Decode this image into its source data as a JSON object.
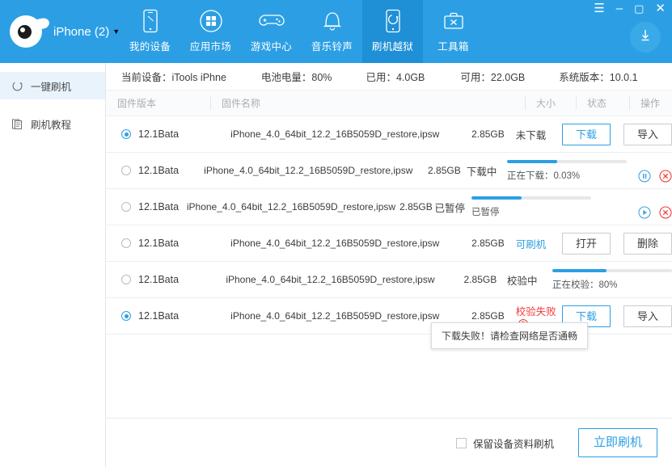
{
  "app": {
    "brand_name": "iPhone (2)",
    "brand_caret": "▼",
    "logo_icon": "itools-eye-logo"
  },
  "topnav": {
    "tabs": [
      {
        "label": "我的设备",
        "icon": "phone-icon",
        "active": false
      },
      {
        "label": "应用市场",
        "icon": "grid-apps-icon",
        "active": false
      },
      {
        "label": "游戏中心",
        "icon": "gamepad-icon",
        "active": false
      },
      {
        "label": "音乐铃声",
        "icon": "bell-icon",
        "active": false
      },
      {
        "label": "刷机越狱",
        "icon": "phone-refresh-icon",
        "active": true
      },
      {
        "label": "工具箱",
        "icon": "toolbox-icon",
        "active": false
      }
    ],
    "window_controls": [
      {
        "name": "menu-icon",
        "glyph": "☰"
      },
      {
        "name": "minimize-icon",
        "glyph": "–"
      },
      {
        "name": "maximize-icon",
        "glyph": "▢"
      },
      {
        "name": "close-icon",
        "glyph": "✕"
      }
    ],
    "download_button_icon": "download-arrow-icon"
  },
  "sidebar": {
    "items": [
      {
        "label": "一键刷机",
        "icon": "refresh-circle-icon",
        "active": true
      },
      {
        "label": "刷机教程",
        "icon": "document-icon",
        "active": false
      }
    ]
  },
  "device_bar": {
    "current_device": "当前设备：iTools iPhne",
    "battery": "电池电量：80%",
    "used": "已用：4.0GB",
    "available": "可用：22.0GB",
    "system_version": "系统版本：10.0.1"
  },
  "table": {
    "headers": {
      "version": "固件版本",
      "name": "固件名称",
      "size": "大小",
      "state": "状态",
      "action": "操作"
    },
    "rows": [
      {
        "selected": true,
        "version": "12.1Bata",
        "name": "iPhone_4.0_64bit_12.2_16B5059D_restore,ipsw",
        "size": "2.85GB",
        "state": "未下载",
        "state_color": "normal",
        "action_type": "buttons",
        "buttons": [
          {
            "label": "下载",
            "style": "primary",
            "name": "download-button"
          },
          {
            "label": "导入",
            "style": "default",
            "name": "import-button"
          }
        ]
      },
      {
        "selected": false,
        "version": "12.1Bata",
        "name": "iPhone_4.0_64bit_12.2_16B5059D_restore,ipsw",
        "size": "2.85GB",
        "state": "下载中",
        "state_color": "normal",
        "action_type": "progress",
        "progress_percent": 42,
        "progress_text": "正在下载：0.03%",
        "controls": [
          {
            "name": "pause-icon",
            "glyph": "pause"
          },
          {
            "name": "cancel-icon",
            "glyph": "cancel"
          }
        ]
      },
      {
        "selected": false,
        "version": "12.1Bata",
        "name": "iPhone_4.0_64bit_12.2_16B5059D_restore,ipsw",
        "size": "2.85GB",
        "state": "已暂停",
        "state_color": "normal",
        "action_type": "progress",
        "progress_percent": 42,
        "progress_text": "已暂停",
        "controls": [
          {
            "name": "play-icon",
            "glyph": "play"
          },
          {
            "name": "cancel-icon",
            "glyph": "cancel"
          }
        ]
      },
      {
        "selected": false,
        "version": "12.1Bata",
        "name": "iPhone_4.0_64bit_12.2_16B5059D_restore,ipsw",
        "size": "2.85GB",
        "state": "可刷机",
        "state_color": "blue",
        "action_type": "buttons",
        "buttons": [
          {
            "label": "打开",
            "style": "default",
            "name": "open-button"
          },
          {
            "label": "删除",
            "style": "default",
            "name": "delete-button"
          }
        ]
      },
      {
        "selected": false,
        "version": "12.1Bata",
        "name": "iPhone_4.0_64bit_12.2_16B5059D_restore,ipsw",
        "size": "2.85GB",
        "state": "校验中",
        "state_color": "normal",
        "action_type": "progress",
        "progress_percent": 45,
        "progress_text": "正在校验：80%",
        "controls": []
      },
      {
        "selected": true,
        "version": "12.1Bata",
        "name": "iPhone_4.0_64bit_12.2_16B5059D_restore,ipsw",
        "size": "2.85GB",
        "state": "校验失败",
        "state_color": "red",
        "state_help_icon": "?",
        "action_type": "buttons",
        "buttons": [
          {
            "label": "下载",
            "style": "primary",
            "name": "download-button"
          },
          {
            "label": "导入",
            "style": "default",
            "name": "import-button"
          }
        ]
      }
    ]
  },
  "tooltip": {
    "text": "下载失败！请检查网络是否通畅"
  },
  "bottom": {
    "keep_data_label": "保留设备资料刷机",
    "keep_data_checked": false,
    "flash_now_label": "立即刷机"
  },
  "colors": {
    "brand_blue": "#2c9fe4",
    "active_tab_blue": "#1f8fd6",
    "error_red": "#f23c3c",
    "sidebar_active": "#e8f3fc"
  }
}
